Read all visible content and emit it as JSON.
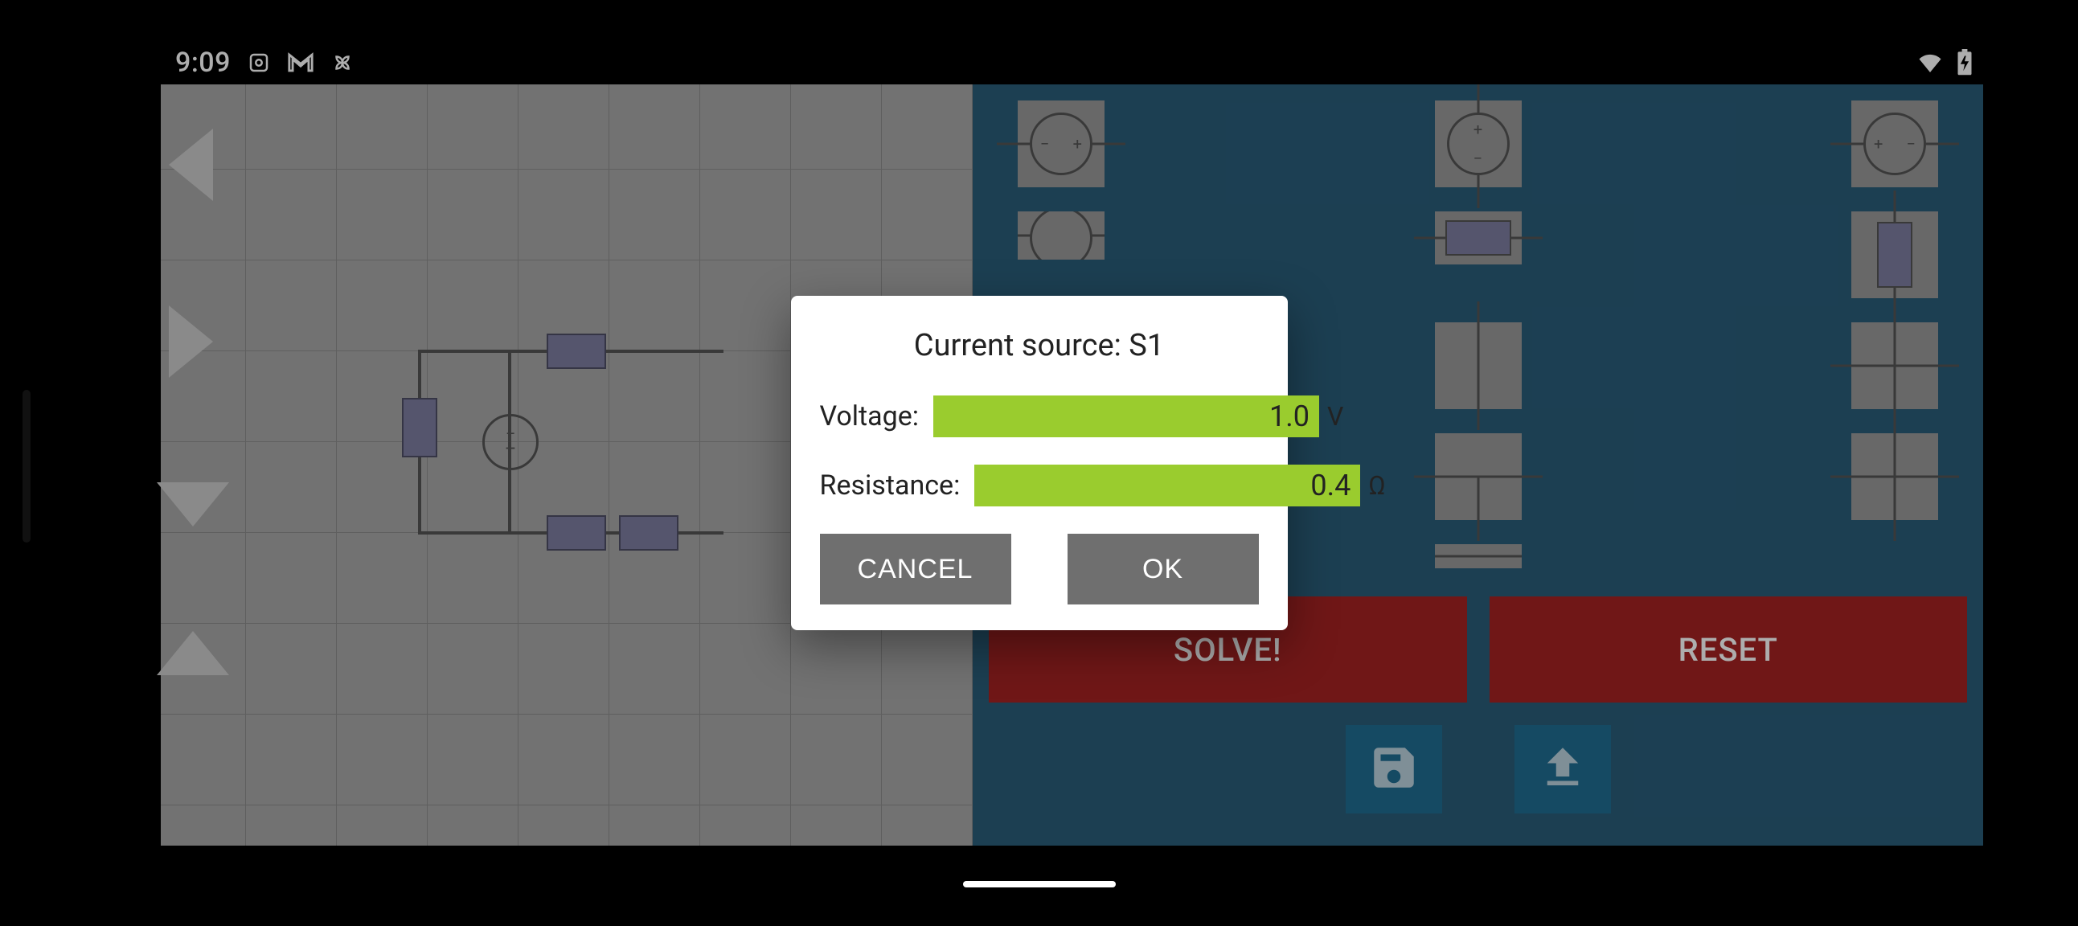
{
  "status": {
    "time": "9:09"
  },
  "actions": {
    "solve": "SOLVE!",
    "reset": "RESET"
  },
  "modal": {
    "title": "Current source: S1",
    "voltage_label": "Voltage:",
    "voltage_value": "1.0",
    "voltage_unit": "V",
    "resistance_label": "Resistance:",
    "resistance_value": "0.4",
    "resistance_unit": "Ω",
    "cancel": "CANCEL",
    "ok": "OK"
  },
  "colors": {
    "accent_input": "#9acc2e",
    "danger": "#a52222",
    "panel": "#2a5d7a"
  }
}
